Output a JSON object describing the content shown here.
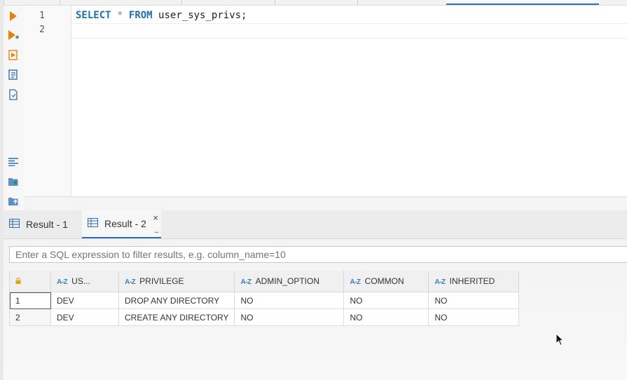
{
  "editor": {
    "line_numbers": [
      "1",
      "2"
    ],
    "sql": {
      "kw_select": "SELECT",
      "star": "*",
      "kw_from": "FROM",
      "table": "user_sys_privs;"
    }
  },
  "results": {
    "tabs": [
      {
        "label": "Result - 1",
        "active": false
      },
      {
        "label": "Result - 2",
        "active": true
      }
    ],
    "close_glyph": "×",
    "more_glyph": "..."
  },
  "filter": {
    "placeholder": "Enter a SQL expression to filter results, e.g. column_name=10"
  },
  "grid": {
    "columns": [
      "US...",
      "PRIVILEGE",
      "ADMIN_OPTION",
      "COMMON",
      "INHERITED"
    ],
    "rows": [
      {
        "num": "1",
        "cells": [
          "DEV",
          "DROP ANY DIRECTORY",
          "NO",
          "NO",
          "NO"
        ]
      },
      {
        "num": "2",
        "cells": [
          "DEV",
          "CREATE ANY DIRECTORY",
          "NO",
          "NO",
          "NO"
        ]
      }
    ]
  },
  "colors": {
    "accent": "#2f6db5",
    "run_icon": "#e8800c",
    "keyword": "#1f6fa8"
  },
  "icons": [
    "execute-statement-icon",
    "execute-in-new-tab-icon",
    "execute-script-icon",
    "execute-script-new-tab-icon",
    "explain-plan-icon",
    "format-sql-icon",
    "save-script-icon",
    "load-script-icon",
    "grid-icon",
    "lock-icon",
    "sort-az-icon"
  ]
}
